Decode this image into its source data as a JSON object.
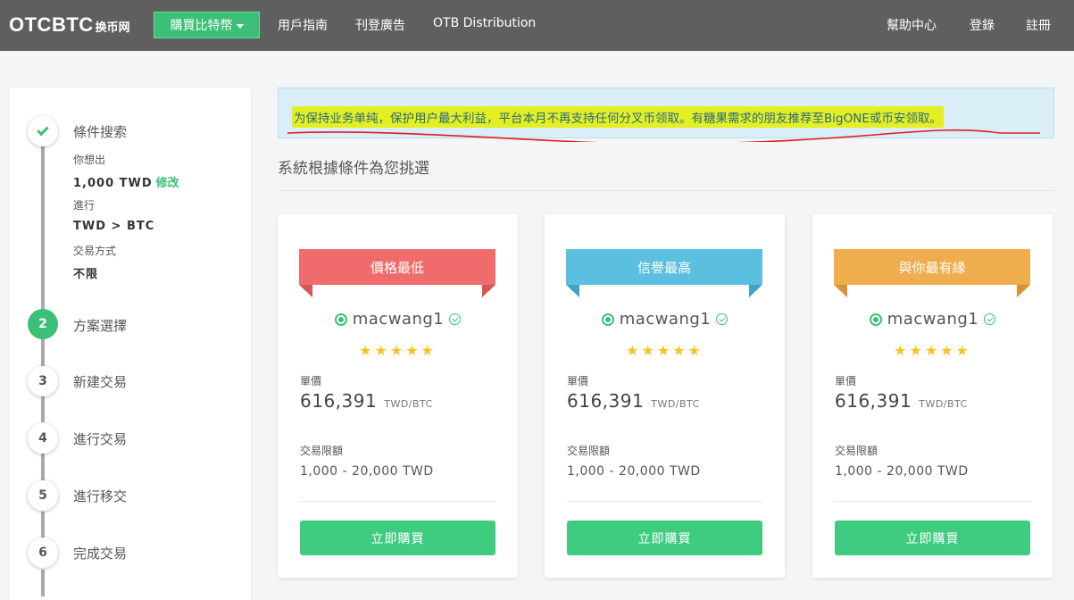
{
  "navbar": {
    "brand": "OTCBTC",
    "brand_sub": "换币网",
    "buy_button": "購買比特幣",
    "links": [
      "用戶指南",
      "刊登廣告",
      "OTB Distribution"
    ],
    "right_links": [
      "幫助中心",
      "登錄",
      "註冊"
    ]
  },
  "sidebar": {
    "steps": [
      {
        "number": "",
        "label": "條件搜索",
        "state": "done"
      },
      {
        "number": "2",
        "label": "方案選擇",
        "state": "active"
      },
      {
        "number": "3",
        "label": "新建交易",
        "state": "pending"
      },
      {
        "number": "4",
        "label": "進行交易",
        "state": "pending"
      },
      {
        "number": "5",
        "label": "進行移交",
        "state": "pending"
      },
      {
        "number": "6",
        "label": "完成交易",
        "state": "pending"
      }
    ],
    "details": {
      "want_label": "你想出",
      "want_value": "1,000 TWD",
      "modify": "修改",
      "proceed_label": "進行",
      "proceed_value": "TWD > BTC",
      "method_label": "交易方式",
      "method_value": "不限"
    }
  },
  "notice": {
    "text": "为保持业务单纯，保护用户最大利益，平台本月不再支持任何分叉币领取。有糖果需求的朋友推荐至BigONE或币安领取。"
  },
  "section_title": "系統根據條件為您挑選",
  "colors": {
    "primary_green": "#3cbf76",
    "red_ribbon": "#f06b6b",
    "blue_ribbon": "#5bbfe0",
    "orange_ribbon": "#f0ad4e",
    "star": "#f5c518",
    "highlight": "#e3ef21"
  },
  "cards": [
    {
      "ribbon": "價格最低",
      "ribbon_color": "#f06b6b",
      "seller": "macwang1",
      "stars": "★★★★★",
      "price_label": "單價",
      "price": "616,391",
      "price_unit": "TWD/BTC",
      "limit_label": "交易限額",
      "limit": "1,000 - 20,000 TWD",
      "button": "立即購買"
    },
    {
      "ribbon": "信譽最高",
      "ribbon_color": "#5bbfe0",
      "seller": "macwang1",
      "stars": "★★★★★",
      "price_label": "單價",
      "price": "616,391",
      "price_unit": "TWD/BTC",
      "limit_label": "交易限額",
      "limit": "1,000 - 20,000 TWD",
      "button": "立即購買"
    },
    {
      "ribbon": "與你最有緣",
      "ribbon_color": "#f0ad4e",
      "seller": "macwang1",
      "stars": "★★★★★",
      "price_label": "單價",
      "price": "616,391",
      "price_unit": "TWD/BTC",
      "limit_label": "交易限額",
      "limit": "1,000 - 20,000 TWD",
      "button": "立即購買"
    }
  ]
}
